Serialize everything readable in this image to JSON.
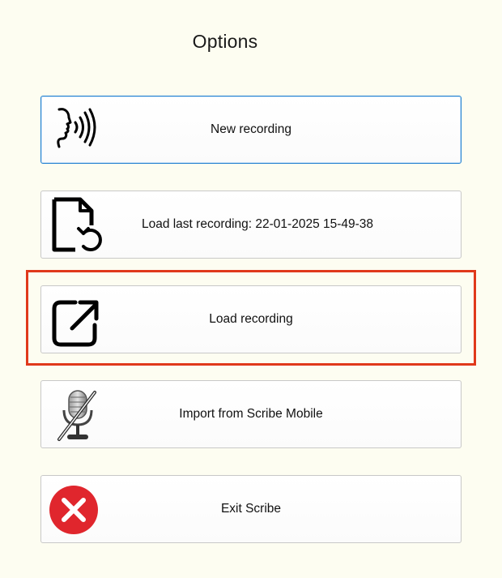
{
  "dialog": {
    "title": "Options"
  },
  "options": [
    {
      "label": "New recording",
      "icon": "speaking-head-icon"
    },
    {
      "label": "Load last recording: 22-01-2025 15-49-38",
      "icon": "file-restore-icon"
    },
    {
      "label": "Load recording",
      "icon": "open-external-icon"
    },
    {
      "label": "Import from Scribe Mobile",
      "icon": "microphone-muted-icon"
    },
    {
      "label": "Exit Scribe",
      "icon": "exit-circle-icon"
    }
  ],
  "colors": {
    "background": "#fdfdf1",
    "focus_border": "#1f7fd1",
    "highlight": "#e0391b",
    "exit_red": "#e0262d"
  }
}
